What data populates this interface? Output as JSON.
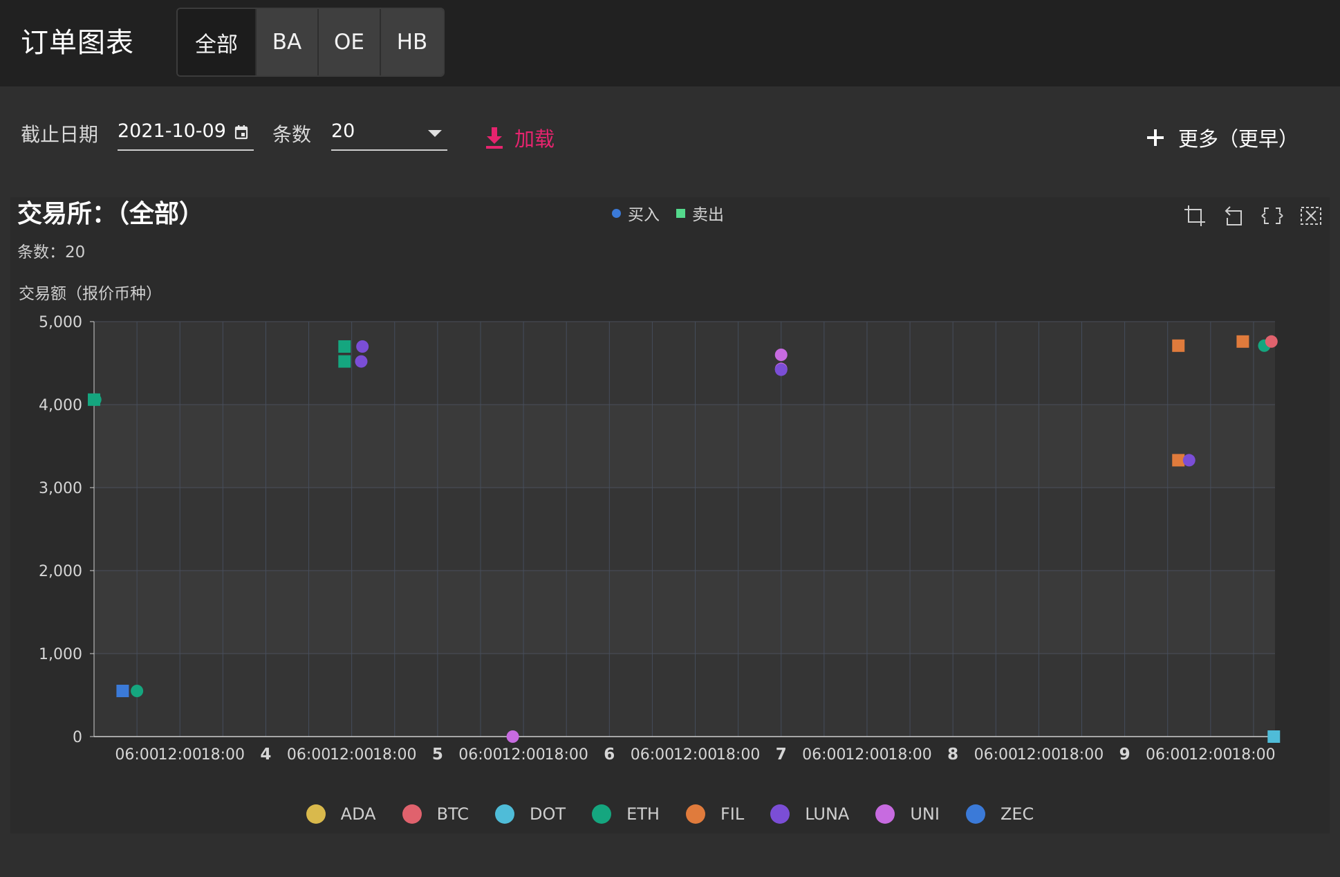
{
  "app": {
    "title": "订单图表",
    "tabs": [
      {
        "label": "全部",
        "active": true
      },
      {
        "label": "BA",
        "active": false
      },
      {
        "label": "OE",
        "active": false
      },
      {
        "label": "HB",
        "active": false
      }
    ]
  },
  "toolbar": {
    "date_label": "截止日期",
    "date_value": "2021-10-09",
    "count_label": "条数",
    "count_value": "20",
    "load_label": "加载",
    "more_label": "更多（更早）"
  },
  "colors": {
    "accent": "#e6246e",
    "ADA": "#d9b94c",
    "BTC": "#e0626d",
    "DOT": "#4fbcd8",
    "ETH": "#15a67f",
    "FIL": "#e07b3c",
    "LUNA": "#7b4ed6",
    "UNI": "#c76be0",
    "ZEC": "#3b7ad8",
    "buy": "#3b7ad8",
    "sell": "#54d98c"
  },
  "icons": [
    "calendar-icon",
    "chevron-down-icon",
    "download-icon",
    "plus-icon",
    "zoom-icon",
    "zoom-reset-icon",
    "restore-icon",
    "clear-icon"
  ],
  "chart_data": {
    "type": "scatter",
    "title": "交易所：（全部）",
    "subtitle": "条数：20",
    "ylabel": "交易额（报价币种）",
    "ylim": [
      0,
      5000
    ],
    "yticks": [
      "0",
      "1,000",
      "2,000",
      "3,000",
      "4,000",
      "5,000"
    ],
    "xlim": [
      "2021-10-03 00:00",
      "2021-10-09 21:00"
    ],
    "xticks": [
      "06:00",
      "12:00",
      "18:00",
      "4",
      "06:00",
      "12:00",
      "18:00",
      "5",
      "06:00",
      "12:00",
      "18:00",
      "6",
      "06:00",
      "12:00",
      "18:00",
      "7",
      "06:00",
      "12:00",
      "18:00",
      "8",
      "06:00",
      "12:00",
      "18:00",
      "9",
      "06:00",
      "12:00",
      "18:00"
    ],
    "grid": true,
    "legend_top": [
      {
        "name": "买入",
        "shape": "circle"
      },
      {
        "name": "卖出",
        "shape": "square"
      }
    ],
    "legend_bottom": [
      "ADA",
      "BTC",
      "DOT",
      "ETH",
      "FIL",
      "LUNA",
      "UNI",
      "ZEC"
    ],
    "points": [
      {
        "x": "2021-10-03 00:00",
        "y": 4060,
        "coin": "ETH",
        "side": "卖出"
      },
      {
        "x": "2021-10-03 00:10",
        "y": 4060,
        "coin": "ETH",
        "side": "买入"
      },
      {
        "x": "2021-10-03 04:00",
        "y": 550,
        "coin": "ZEC",
        "side": "卖出"
      },
      {
        "x": "2021-10-03 06:00",
        "y": 550,
        "coin": "ETH",
        "side": "买入"
      },
      {
        "x": "2021-10-04 11:00",
        "y": 4700,
        "coin": "ETH",
        "side": "卖出"
      },
      {
        "x": "2021-10-04 11:00",
        "y": 4520,
        "coin": "ETH",
        "side": "卖出"
      },
      {
        "x": "2021-10-04 13:30",
        "y": 4700,
        "coin": "LUNA",
        "side": "买入"
      },
      {
        "x": "2021-10-04 13:20",
        "y": 4520,
        "coin": "LUNA",
        "side": "买入"
      },
      {
        "x": "2021-10-05 10:30",
        "y": 0,
        "coin": "UNI",
        "side": "买入"
      },
      {
        "x": "2021-10-07 00:00",
        "y": 4600,
        "coin": "UNI",
        "side": "买入"
      },
      {
        "x": "2021-10-07 00:00",
        "y": 4430,
        "coin": "UNI",
        "side": "买入"
      },
      {
        "x": "2021-10-07 00:00",
        "y": 4420,
        "coin": "LUNA",
        "side": "买入"
      },
      {
        "x": "2021-10-09 07:30",
        "y": 4710,
        "coin": "FIL",
        "side": "卖出"
      },
      {
        "x": "2021-10-09 07:30",
        "y": 3330,
        "coin": "FIL",
        "side": "卖出"
      },
      {
        "x": "2021-10-09 09:00",
        "y": 3330,
        "coin": "LUNA",
        "side": "买入"
      },
      {
        "x": "2021-10-09 16:30",
        "y": 4760,
        "coin": "FIL",
        "side": "卖出"
      },
      {
        "x": "2021-10-09 19:30",
        "y": 4710,
        "coin": "ETH",
        "side": "买入"
      },
      {
        "x": "2021-10-09 20:30",
        "y": 4760,
        "coin": "BTC",
        "side": "买入"
      },
      {
        "x": "2021-10-09 20:50",
        "y": 0,
        "coin": "DOT",
        "side": "卖出"
      }
    ]
  }
}
